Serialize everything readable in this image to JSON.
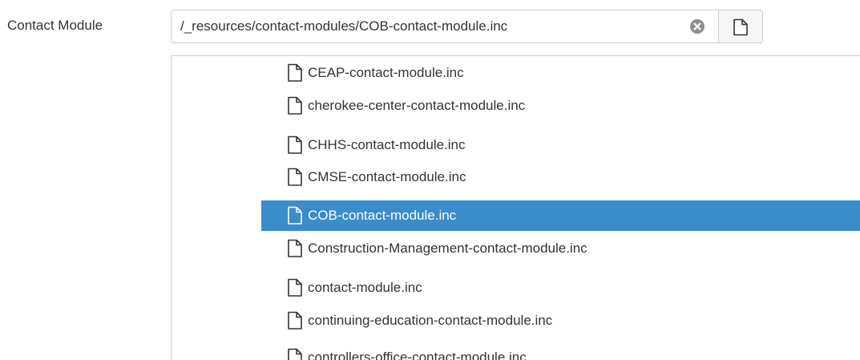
{
  "form": {
    "label": "Contact Module",
    "path_value": "/_resources/contact-modules/COB-contact-module.inc",
    "clear_icon": "clear-icon",
    "browse_icon": "file-icon"
  },
  "file_browser": {
    "selected_index": 4,
    "items": [
      {
        "name": "CEAP-contact-module.inc",
        "icon": "file-icon"
      },
      {
        "name": "cherokee-center-contact-module.inc",
        "icon": "file-icon"
      },
      {
        "name": "CHHS-contact-module.inc",
        "icon": "file-icon"
      },
      {
        "name": "CMSE-contact-module.inc",
        "icon": "file-icon"
      },
      {
        "name": "COB-contact-module.inc",
        "icon": "file-icon"
      },
      {
        "name": "Construction-Management-contact-module.inc",
        "icon": "file-icon"
      },
      {
        "name": "contact-module.inc",
        "icon": "file-icon"
      },
      {
        "name": "continuing-education-contact-module.inc",
        "icon": "file-icon"
      },
      {
        "name": "controllers-office-contact-module.inc",
        "icon": "file-icon"
      }
    ]
  },
  "colors": {
    "selected_row": "#3a8cca",
    "selected_text": "#ffffff",
    "border": "#cccccc",
    "text": "#333333"
  }
}
